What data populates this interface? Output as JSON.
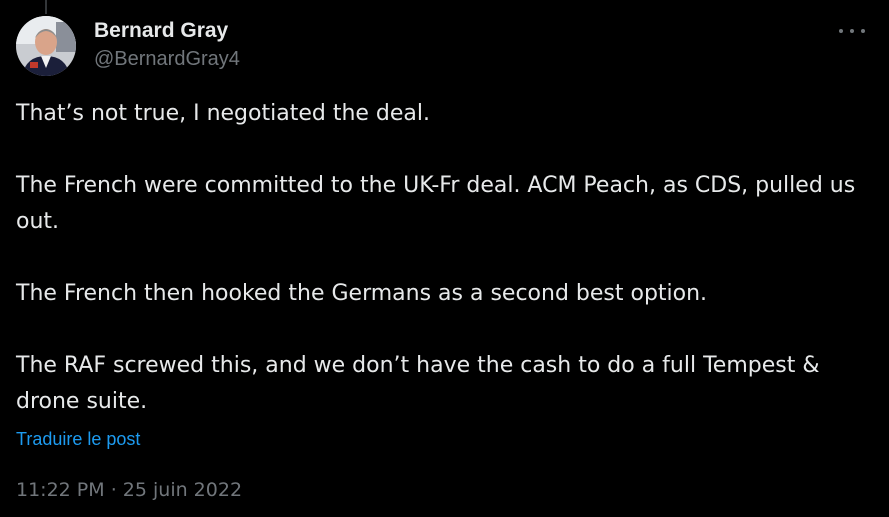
{
  "author": {
    "display_name": "Bernard Gray",
    "handle": "@BernardGray4"
  },
  "more_icon": "more-horizontal-icon",
  "tweet": {
    "paragraphs": [
      "That’s not true, I negotiated the deal.",
      "The French were committed to the UK-Fr deal. ACM Peach, as CDS, pulled us out.",
      "The French then hooked the Germans as a second best option.",
      "The RAF screwed this, and we don’t have the cash to do a full Tempest & drone suite."
    ],
    "translate_label": "Traduire le post",
    "time": "11:22 PM",
    "separator": " · ",
    "date": "25 juin 2022"
  },
  "colors": {
    "background": "#000000",
    "text_primary": "#e7e9ea",
    "text_secondary": "#71767b",
    "link": "#1d9bf0"
  }
}
